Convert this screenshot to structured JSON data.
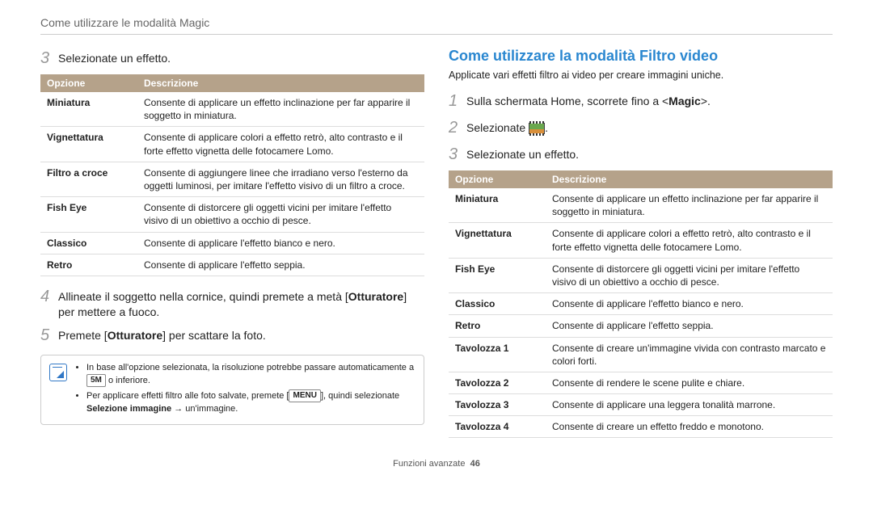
{
  "header": {
    "title": "Come utilizzare le modalità Magic"
  },
  "left": {
    "step3": {
      "num": "3",
      "text": "Selezionate un effetto."
    },
    "table": {
      "headers": [
        "Opzione",
        "Descrizione"
      ],
      "rows": [
        {
          "opt": "Miniatura",
          "desc": "Consente di applicare un effetto inclinazione per far apparire il soggetto in miniatura."
        },
        {
          "opt": "Vignettatura",
          "desc": "Consente di applicare colori a effetto retrò, alto contrasto e il forte effetto vignetta delle fotocamere Lomo."
        },
        {
          "opt": "Filtro a croce",
          "desc": "Consente di aggiungere linee che irradiano verso l'esterno da oggetti luminosi, per imitare l'effetto visivo di un filtro a croce."
        },
        {
          "opt": "Fish Eye",
          "desc": "Consente di distorcere gli oggetti vicini per imitare l'effetto visivo di un obiettivo a occhio di pesce."
        },
        {
          "opt": "Classico",
          "desc": "Consente di applicare l'effetto bianco e nero."
        },
        {
          "opt": "Retro",
          "desc": "Consente di applicare l'effetto seppia."
        }
      ]
    },
    "step4": {
      "num": "4",
      "text_a": "Allineate il soggetto nella cornice, quindi premete a metà [",
      "bold_a": "Otturatore",
      "text_b": "] per mettere a fuoco."
    },
    "step5": {
      "num": "5",
      "text_a": "Premete [",
      "bold_a": "Otturatore",
      "text_b": "] per scattare la foto."
    },
    "note": {
      "li1_a": "In base all'opzione selezionata, la risoluzione potrebbe passare automaticamente a ",
      "li1_key": "5M",
      "li1_b": " o inferiore.",
      "li2_a": "Per applicare effetti filtro alle foto salvate, premete [",
      "li2_key": "MENU",
      "li2_b": "], quindi selezionate ",
      "li2_bold": "Selezione immagine",
      "li2_c": " → un'immagine."
    }
  },
  "right": {
    "heading": "Come utilizzare la modalità Filtro video",
    "intro": "Applicate vari effetti filtro ai video per creare immagini uniche.",
    "step1": {
      "num": "1",
      "text_a": "Sulla schermata Home, scorrete fino a <",
      "bold": "Magic",
      "text_b": ">."
    },
    "step2": {
      "num": "2",
      "text": "Selezionate "
    },
    "step3": {
      "num": "3",
      "text": "Selezionate un effetto."
    },
    "table": {
      "headers": [
        "Opzione",
        "Descrizione"
      ],
      "rows": [
        {
          "opt": "Miniatura",
          "desc": "Consente di applicare un effetto inclinazione per far apparire il soggetto in miniatura."
        },
        {
          "opt": "Vignettatura",
          "desc": "Consente di applicare colori a effetto retrò, alto contrasto e il forte effetto vignetta delle fotocamere Lomo."
        },
        {
          "opt": "Fish Eye",
          "desc": "Consente di distorcere gli oggetti vicini per imitare l'effetto visivo di un obiettivo a occhio di pesce."
        },
        {
          "opt": "Classico",
          "desc": "Consente di applicare l'effetto bianco e nero."
        },
        {
          "opt": "Retro",
          "desc": "Consente di applicare l'effetto seppia."
        },
        {
          "opt": "Tavolozza 1",
          "desc": "Consente di creare un'immagine vivida con contrasto marcato e colori forti."
        },
        {
          "opt": "Tavolozza 2",
          "desc": "Consente di rendere le scene pulite e chiare."
        },
        {
          "opt": "Tavolozza 3",
          "desc": "Consente di applicare una leggera tonalità marrone."
        },
        {
          "opt": "Tavolozza 4",
          "desc": "Consente di creare un effetto freddo e monotono."
        }
      ]
    }
  },
  "footer": {
    "label": "Funzioni avanzate",
    "page": "46"
  }
}
